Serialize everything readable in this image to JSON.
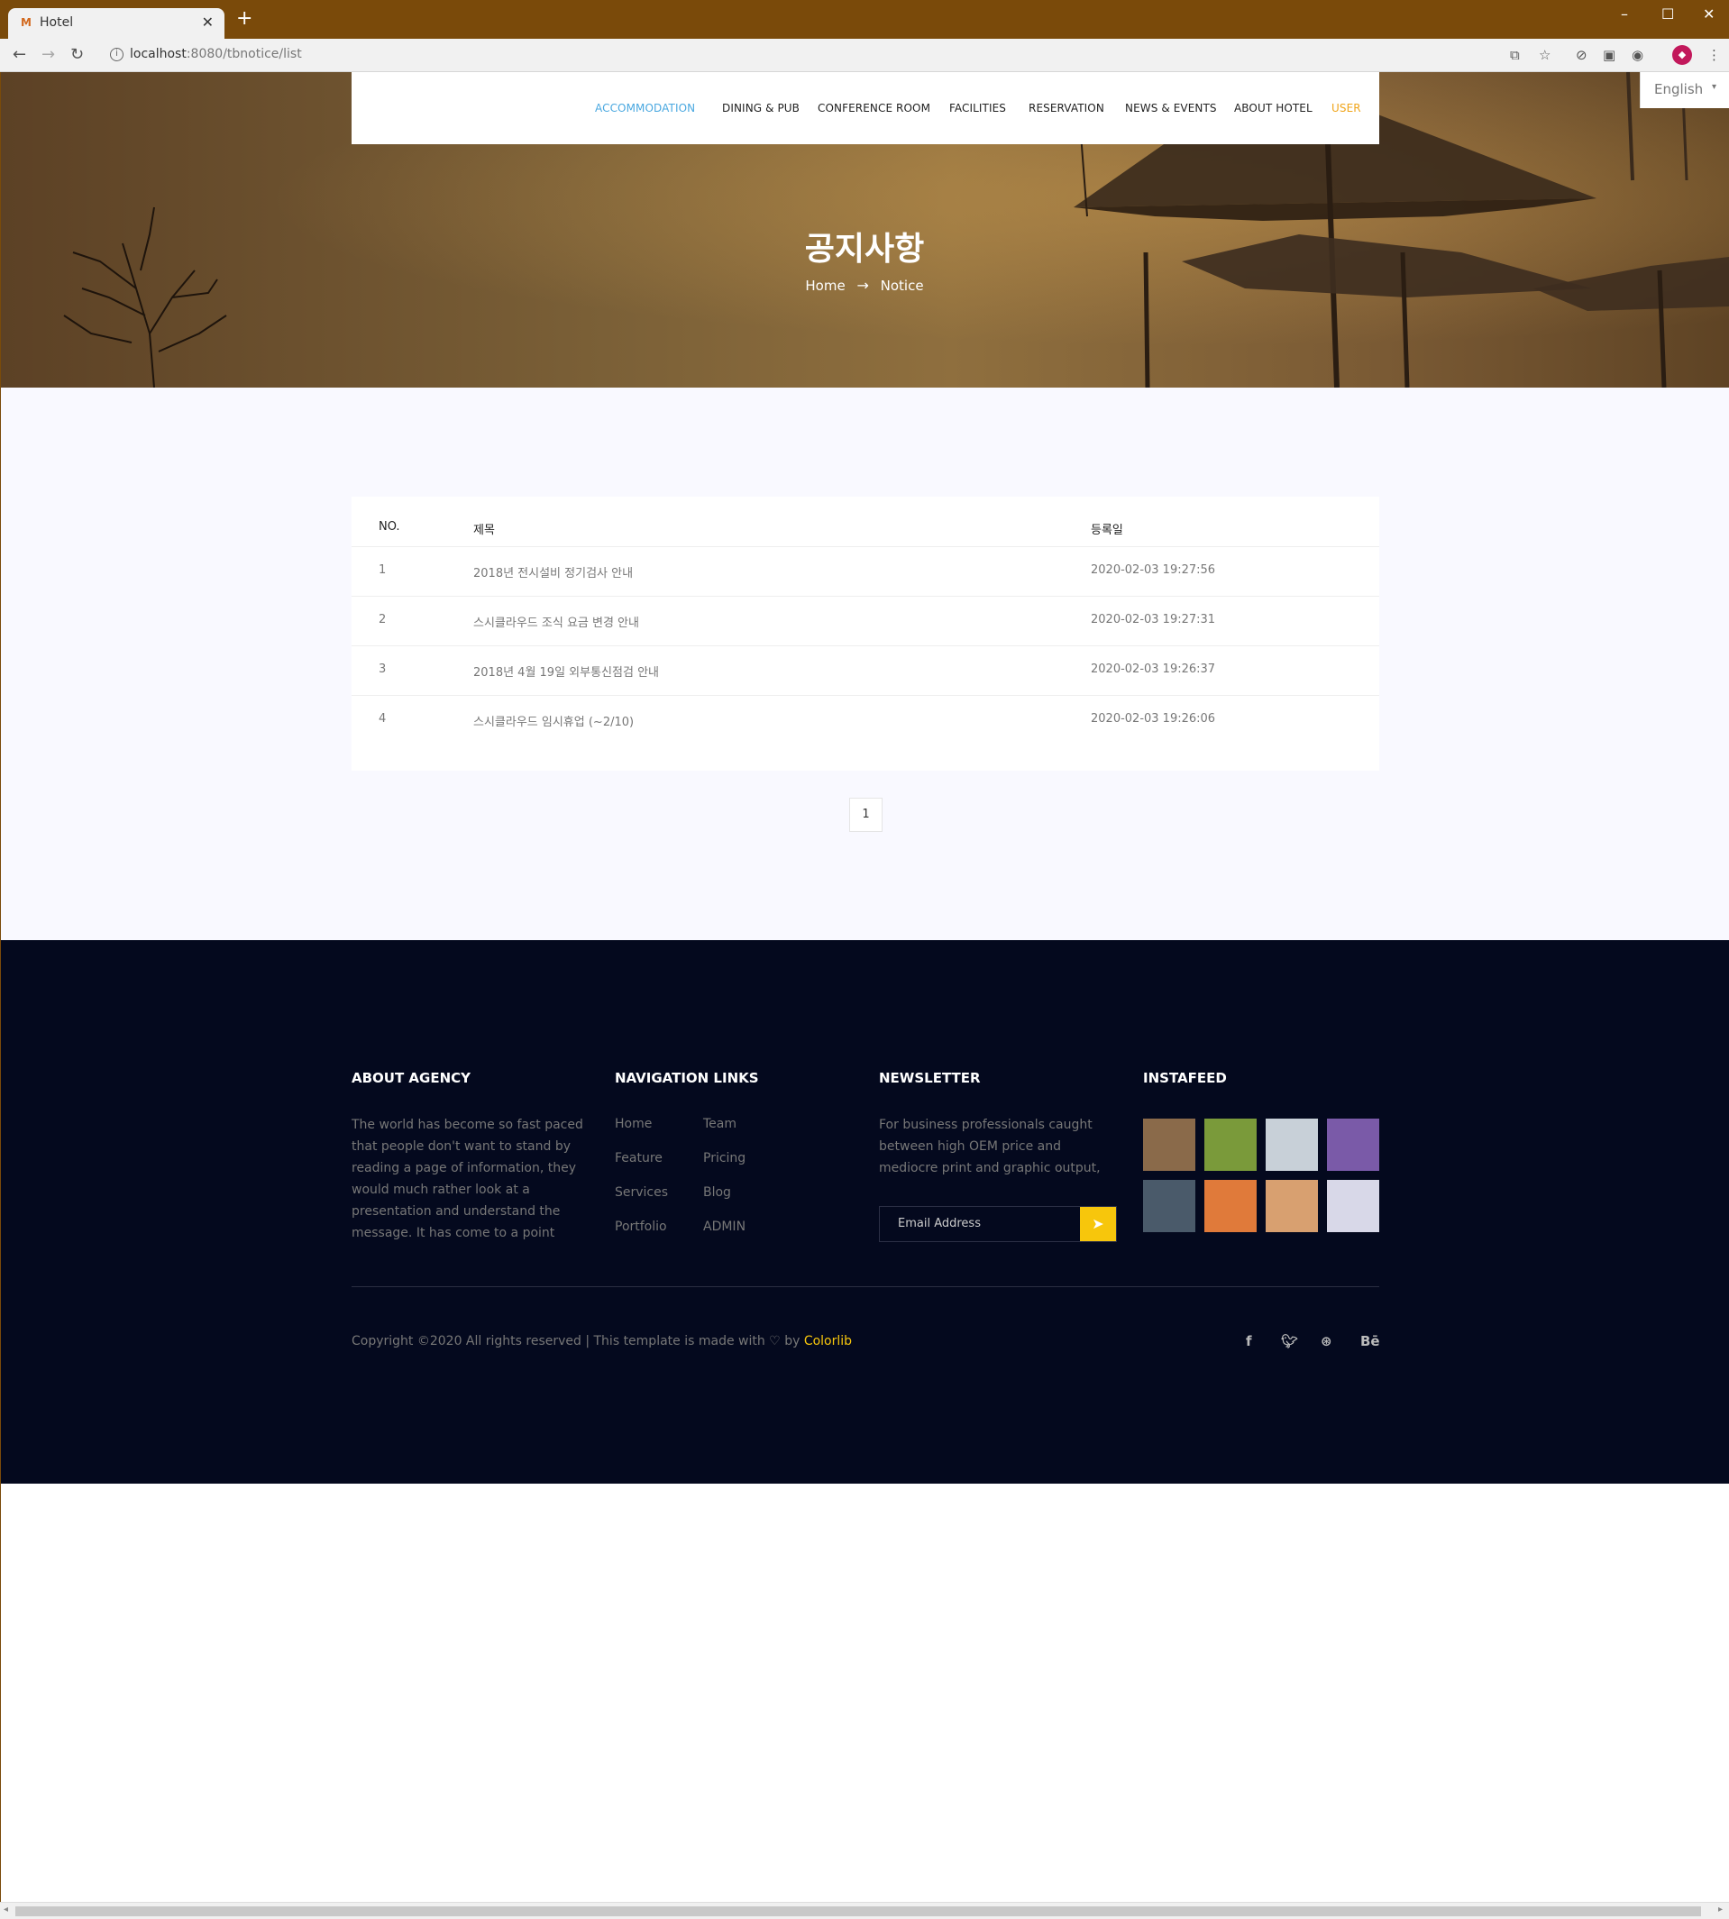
{
  "browser": {
    "tab_title": "Hotel",
    "tab_favicon": "M",
    "url_host": "localhost",
    "url_rest": ":8080/tbnotice/list"
  },
  "header": {
    "language": "English",
    "menu": [
      {
        "label": "ACCOMMODATION"
      },
      {
        "label": "DINING & PUB"
      },
      {
        "label": "CONFERENCE ROOM"
      },
      {
        "label": "FACILITIES"
      },
      {
        "label": "RESERVATION"
      },
      {
        "label": "NEWS & EVENTS"
      },
      {
        "label": "ABOUT HOTEL"
      },
      {
        "label": "USER"
      }
    ]
  },
  "hero": {
    "title": "공지사항",
    "breadcrumb_home": "Home",
    "breadcrumb_current": "Notice"
  },
  "notice_table": {
    "headers": {
      "no": "NO.",
      "title": "제목",
      "date": "등록일"
    },
    "rows": [
      {
        "no": "1",
        "title": "2018년 전시설비 정기검사 안내",
        "date": "2020-02-03 19:27:56"
      },
      {
        "no": "2",
        "title": "스시클라우드 조식 요금 변경 안내",
        "date": "2020-02-03 19:27:31"
      },
      {
        "no": "3",
        "title": "2018년 4월 19일 외부통신점검 안내",
        "date": "2020-02-03 19:26:37"
      },
      {
        "no": "4",
        "title": "스시클라우드 임시휴업 (~2/10)",
        "date": "2020-02-03 19:26:06"
      }
    ]
  },
  "pagination": {
    "current": "1"
  },
  "footer": {
    "about": {
      "heading": "ABOUT AGENCY",
      "lines": [
        "The world has become so fast paced",
        "that people don't want to stand by",
        "reading a page of information, they",
        "would much rather look at a",
        "presentation and understand the",
        "message. It has come to a point"
      ]
    },
    "nav": {
      "heading": "NAVIGATION LINKS",
      "col1": [
        "Home",
        "Feature",
        "Services",
        "Portfolio"
      ],
      "col2": [
        "Team",
        "Pricing",
        "Blog",
        "ADMIN"
      ]
    },
    "newsletter": {
      "heading": "NEWSLETTER",
      "lines": [
        "For business professionals caught",
        "between high OEM price and",
        "mediocre print and graphic output,"
      ],
      "placeholder": "Email Address"
    },
    "instafeed": {
      "heading": "INSTAFEED",
      "colors": [
        "#8a6a4a",
        "#7a9a3a",
        "#c8d0d8",
        "#7a5aa8",
        "#4a5a6a",
        "#e07a3a",
        "#d8a070",
        "#d8d8e8"
      ]
    },
    "copyright_prefix": "Copyright ©2020 All rights reserved | This template is made with",
    "copyright_by": "by",
    "copyright_brand": "Colorlib",
    "social": [
      "f",
      "t",
      "dribbble",
      "Bē"
    ],
    "social_labels": {
      "facebook": "f",
      "behance": "Bē"
    }
  }
}
